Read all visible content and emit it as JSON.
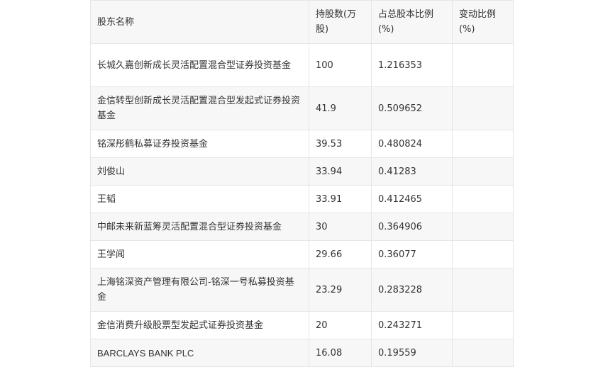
{
  "table": {
    "headers": [
      "股东名称",
      "持股数(万股)",
      "占总股本比例(%)",
      "变动比例(%)"
    ],
    "rows": [
      {
        "name": "长城久嘉创新成长灵活配置混合型证券投资基金",
        "shares": "100",
        "ratio": "1.216353",
        "change": ""
      },
      {
        "name": "金信转型创新成长灵活配置混合型发起式证券投资基金",
        "shares": "41.9",
        "ratio": "0.509652",
        "change": ""
      },
      {
        "name": "铭深彤鹤私募证券投资基金",
        "shares": "39.53",
        "ratio": "0.480824",
        "change": ""
      },
      {
        "name": "刘俊山",
        "shares": "33.94",
        "ratio": "0.41283",
        "change": ""
      },
      {
        "name": "王韬",
        "shares": "33.91",
        "ratio": "0.412465",
        "change": ""
      },
      {
        "name": "中邮未来新蓝筹灵活配置混合型证券投资基金",
        "shares": "30",
        "ratio": "0.364906",
        "change": ""
      },
      {
        "name": "王学闻",
        "shares": "29.66",
        "ratio": "0.36077",
        "change": ""
      },
      {
        "name": "上海铭深资产管理有限公司-铭深一号私募投资基金",
        "shares": "23.29",
        "ratio": "0.283228",
        "change": ""
      },
      {
        "name": "金信消费升级股票型发起式证券投资基金",
        "shares": "20",
        "ratio": "0.243271",
        "change": ""
      },
      {
        "name": "BARCLAYS BANK PLC",
        "shares": "16.08",
        "ratio": "0.19559",
        "change": ""
      }
    ]
  }
}
